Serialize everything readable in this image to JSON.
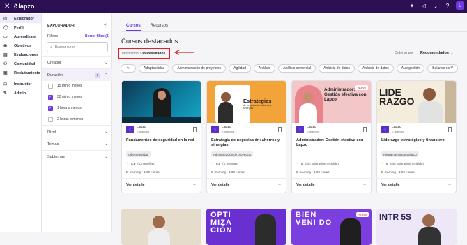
{
  "topbar": {
    "logo": "lapzo"
  },
  "nav": [
    {
      "label": "Explorador",
      "icon": "compass-icon"
    },
    {
      "label": "Perfil",
      "icon": "user-icon"
    },
    {
      "label": "Aprendizaje",
      "icon": "book-icon"
    },
    {
      "label": "Objetivos",
      "icon": "target-icon"
    },
    {
      "label": "Evaluaciones",
      "icon": "chart-icon"
    },
    {
      "label": "Comunidad",
      "icon": "people-icon"
    },
    {
      "label": "Reclutamiento",
      "icon": "briefcase-icon"
    },
    {
      "label": "Instructor",
      "icon": "teacher-icon"
    },
    {
      "label": "Admin",
      "icon": "wrench-icon"
    }
  ],
  "filters": {
    "title": "EXPLORADOR",
    "filtros": "Filtros",
    "borrar": "Borrar filtro (1)",
    "search_placeholder": "Buscar curso",
    "sections": {
      "creador": "Creador",
      "duracion": "Duración",
      "duracion_badge": "2",
      "nivel": "Nivel",
      "temas": "Temas",
      "subtemas": "Subtemas"
    },
    "duration_options": [
      "15 min o menos",
      "30 min o menos",
      "1 hora o menos",
      "2 horas o menos"
    ]
  },
  "main": {
    "tabs": [
      "Cursos",
      "Recursos"
    ],
    "heading": "Cursos destacados",
    "showing_label": "Mostrando",
    "showing_count": "138 Resultados",
    "order_label": "Ordenar por",
    "order_value": "Recomendados",
    "chips": [
      "Adaptabilidad",
      "Administración de proyectos",
      "Agilidad",
      "Análisis",
      "Análisis comercial",
      "Análisis de datos",
      "Análisis de datos",
      "Autogestión",
      "Balance de V"
    ]
  },
  "cards": [
    {
      "provider": "Lapzo",
      "type": "E-learning",
      "title": "Fundamentos de seguridad en la red",
      "tag": "Ciberseguridad",
      "rating": "4.6",
      "reviews": "(13 reseñas)",
      "meta": "E-learning • 1.00 Horas",
      "link": "Ver detalle"
    },
    {
      "provider": "Lapzo",
      "type": "E-learning",
      "title": "Estrategia de negociación: ahorros y sinergias",
      "tag": "Administración de proyectos",
      "rating": "5.0",
      "reviews": "(1 reseñas)",
      "meta": "E-learning • 1.00 Horas",
      "link": "Ver detalle",
      "img_title": "Estrategias",
      "img_sub": "de negociación: ahorros y sinergias"
    },
    {
      "provider": "Lapzo",
      "type": "E-learning",
      "title": "Administrador: Gestión efectiva con Lapzo",
      "tag": "",
      "rating": "0",
      "reviews": "(Sin valoración recibida)",
      "meta": "E-learning • 1.00 Horas",
      "link": "Ver detalle",
      "badge": "Nuevo",
      "img_title": "Administrador: Gestión efectiva con Lapzo"
    },
    {
      "provider": "Lapzo",
      "type": "E-learning",
      "title": "Liderazgo estratégico y financiero",
      "tag": "Pensamiento Estratégico",
      "rating": "0",
      "reviews": "(Sin valoración recibida)",
      "meta": "E-learning • 1.00 Horas",
      "link": "Ver detalle",
      "img_title": "LIDE RAZGO"
    }
  ],
  "row2": [
    {
      "text": ""
    },
    {
      "text": "OPTI MIZA CIÓN"
    },
    {
      "text": "BIEN VENI DO",
      "badge": "Nuevo"
    },
    {
      "text": "INTR 5S"
    }
  ]
}
